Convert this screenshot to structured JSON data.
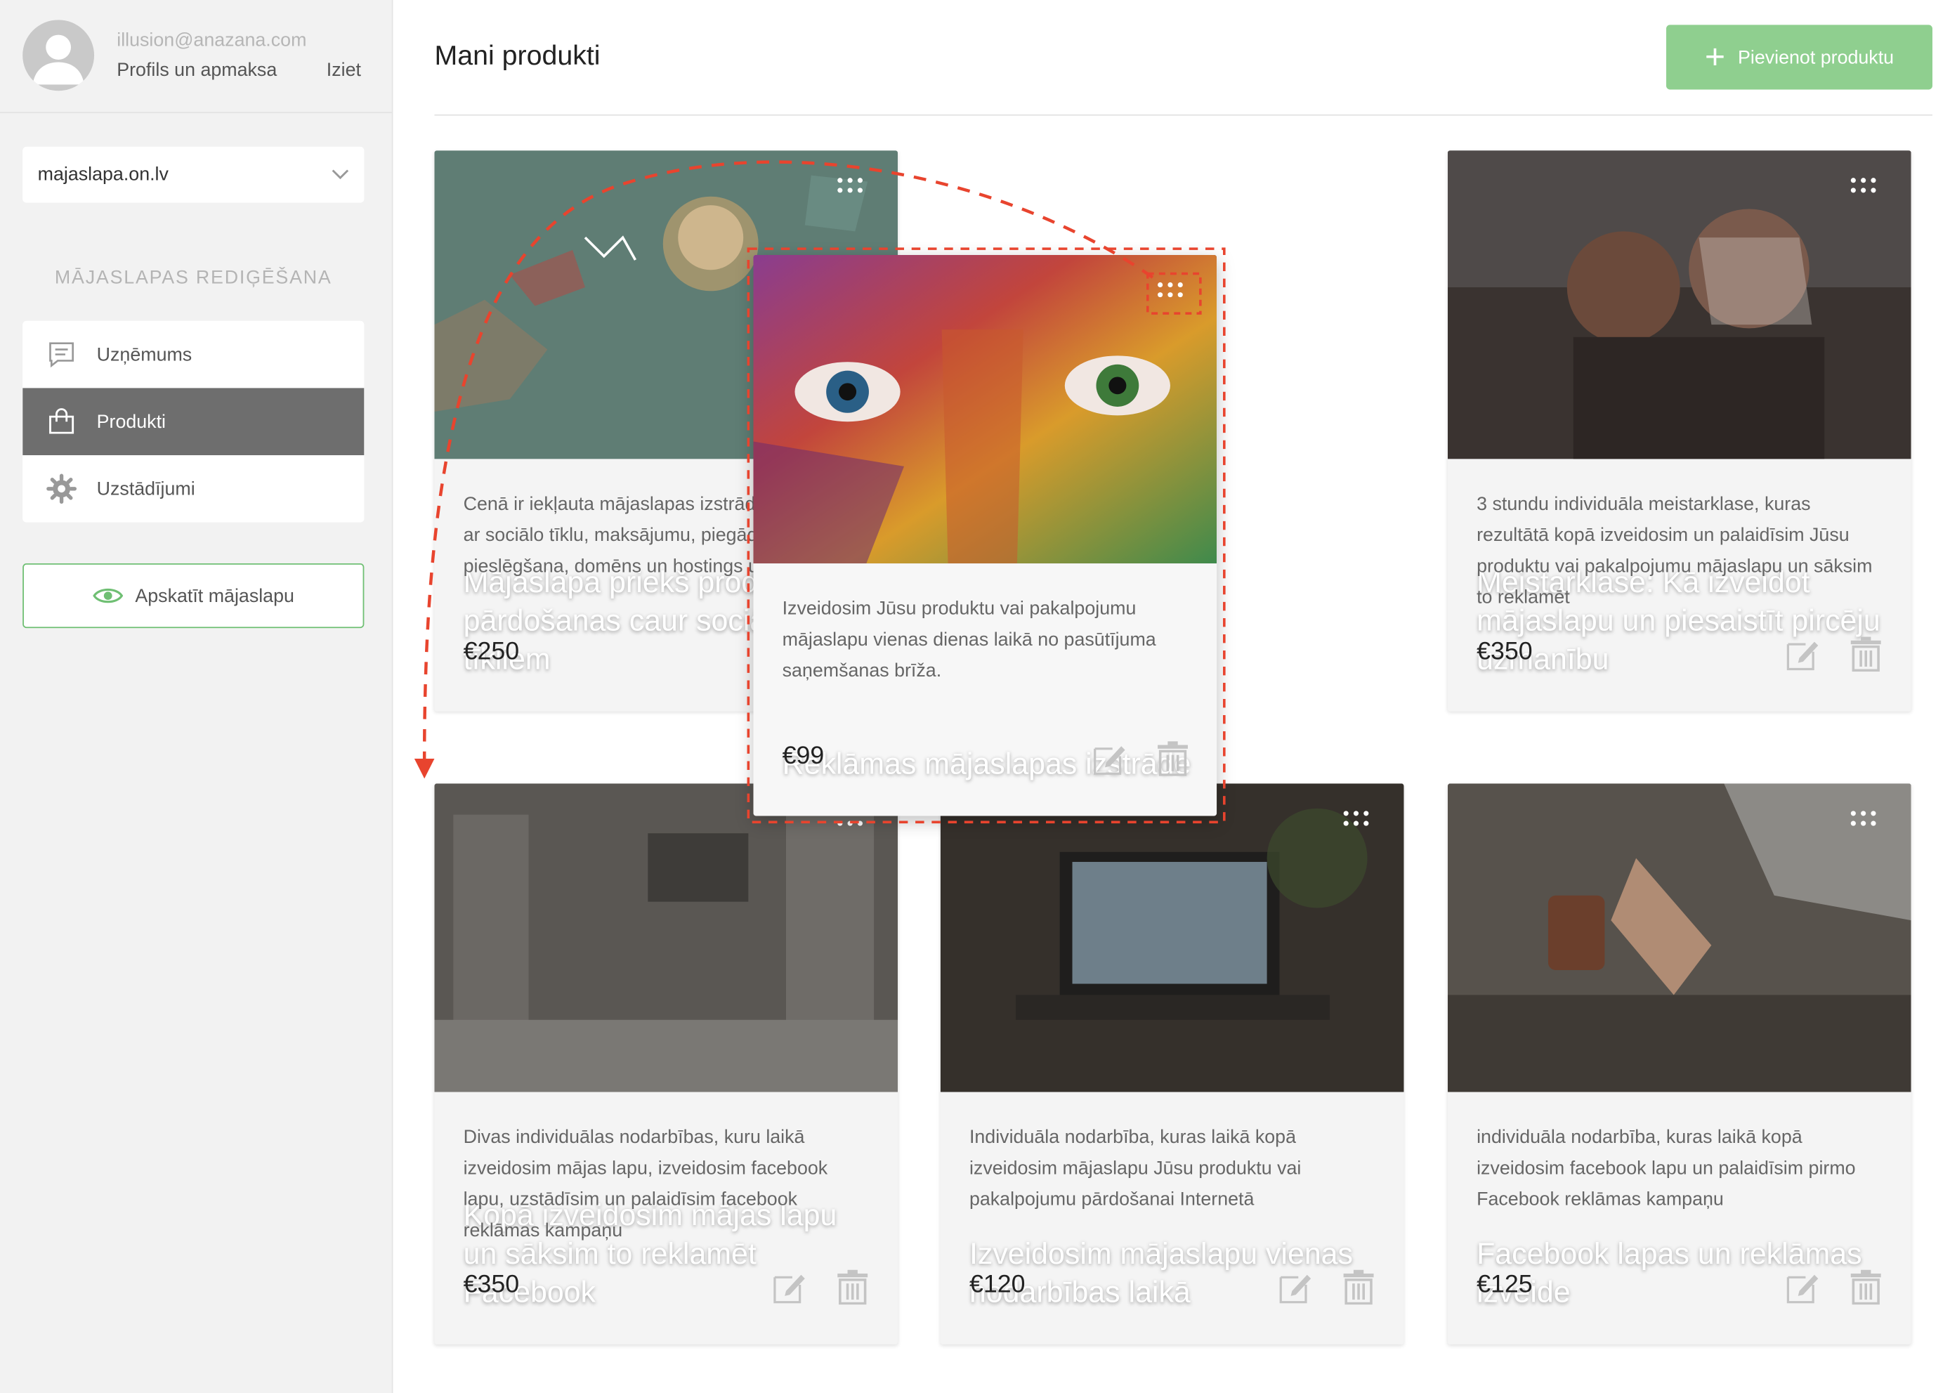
{
  "user": {
    "email": "illusion@anazana.com",
    "profile_link": "Profils un apmaksa",
    "logout_link": "Iziet"
  },
  "site_select": {
    "value": "majaslapa.on.lv"
  },
  "sidebar": {
    "section_title": "MĀJASLAPAS REDIĢĒŠANA",
    "items": [
      {
        "label": "Uzņēmums",
        "icon": "message-icon"
      },
      {
        "label": "Produkti",
        "icon": "shopping-bag-icon",
        "active": true
      },
      {
        "label": "Uzstādījumi",
        "icon": "gear-icon"
      }
    ],
    "view_button": "Apskatīt mājaslapu"
  },
  "header": {
    "title": "Mani produkti",
    "add_button": "Pievienot produktu"
  },
  "colors": {
    "accent_green": "#8fcf8f",
    "view_border": "#6fbf73",
    "drag_highlight": "#e8442e",
    "active_nav": "#6e6e6e"
  },
  "products": [
    {
      "title": "Mājaslapa priekš produktu pārdošanas caur sociālajiem tīkliem",
      "description": "Cenā ir iekļauta mājaslapas izstrāde, integrācija ar sociālo tīklu, maksājumu, piegādes pieslēgšana, domēns un hostings uz gadu.",
      "price": "€250"
    },
    {
      "title": "Meistarklase: Kā izveidot mājaslapu un piesaistīt pircēju uzmanību",
      "description": "3 stundu individuāla meistarklase, kuras rezultātā kopā izveidosim un palaidīsim Jūsu produktu vai pakalpojumu mājaslapu un sāksim to reklamēt",
      "price": "€350"
    },
    {
      "title": "Kopā izveidosim mājas lapu un sāksim to reklamēt Facebook",
      "description": "Divas individuālas nodarbības, kuru laikā izveidosim mājas lapu, izveidosim facebook lapu, uzstādīsim un palaidīsim facebook reklāmas kampaņu",
      "price": "€350"
    },
    {
      "title": "Izveidosim mājaslapu vienas nodarbības laikā",
      "description": "Individuāla nodarbība, kuras laikā kopā izveidosim mājaslapu Jūsu produktu vai pakalpojumu pārdošanai Internetā",
      "price": "€120"
    },
    {
      "title": "Facebook lapas un reklāmas izveide",
      "description": "individuāla nodarbība, kuras laikā kopā izveidosim facebook lapu un palaidīsim pirmo Facebook reklāmas kampaņu",
      "price": "€125"
    }
  ],
  "dragged_product": {
    "title": "Reklāmas mājaslapas izstrāde",
    "description": "Izveidosim Jūsu produktu vai pakalpojumu mājaslapu vienas dienas laikā no pasūtījuma saņemšanas brīža.",
    "price": "€99"
  }
}
